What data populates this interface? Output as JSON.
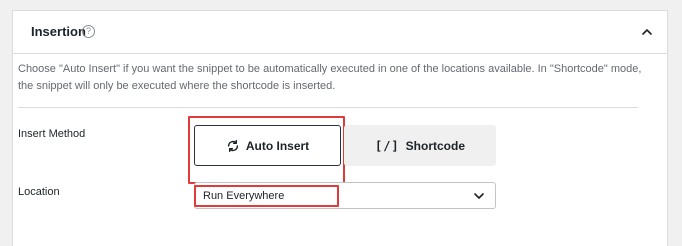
{
  "panel": {
    "title": "Insertion",
    "help_icon": "question-circle-icon",
    "collapse_icon": "chevron-up-icon",
    "description": "Choose \"Auto Insert\" if you want the snippet to be automatically executed in one of the locations available. In \"Shortcode\" mode, the snippet will only be executed where the shortcode is inserted."
  },
  "insert_method": {
    "label": "Insert Method",
    "auto_insert": {
      "label": "Auto Insert",
      "icon": "refresh-icon",
      "selected": true
    },
    "shortcode": {
      "label": "Shortcode",
      "icon_text": "[/]"
    }
  },
  "location": {
    "label": "Location",
    "selected": "Run Everywhere",
    "icon": "chevron-down-icon"
  },
  "colors": {
    "highlight": "#e03b3b",
    "panel_bg": "#ffffff",
    "page_bg": "#f0f0f1"
  }
}
